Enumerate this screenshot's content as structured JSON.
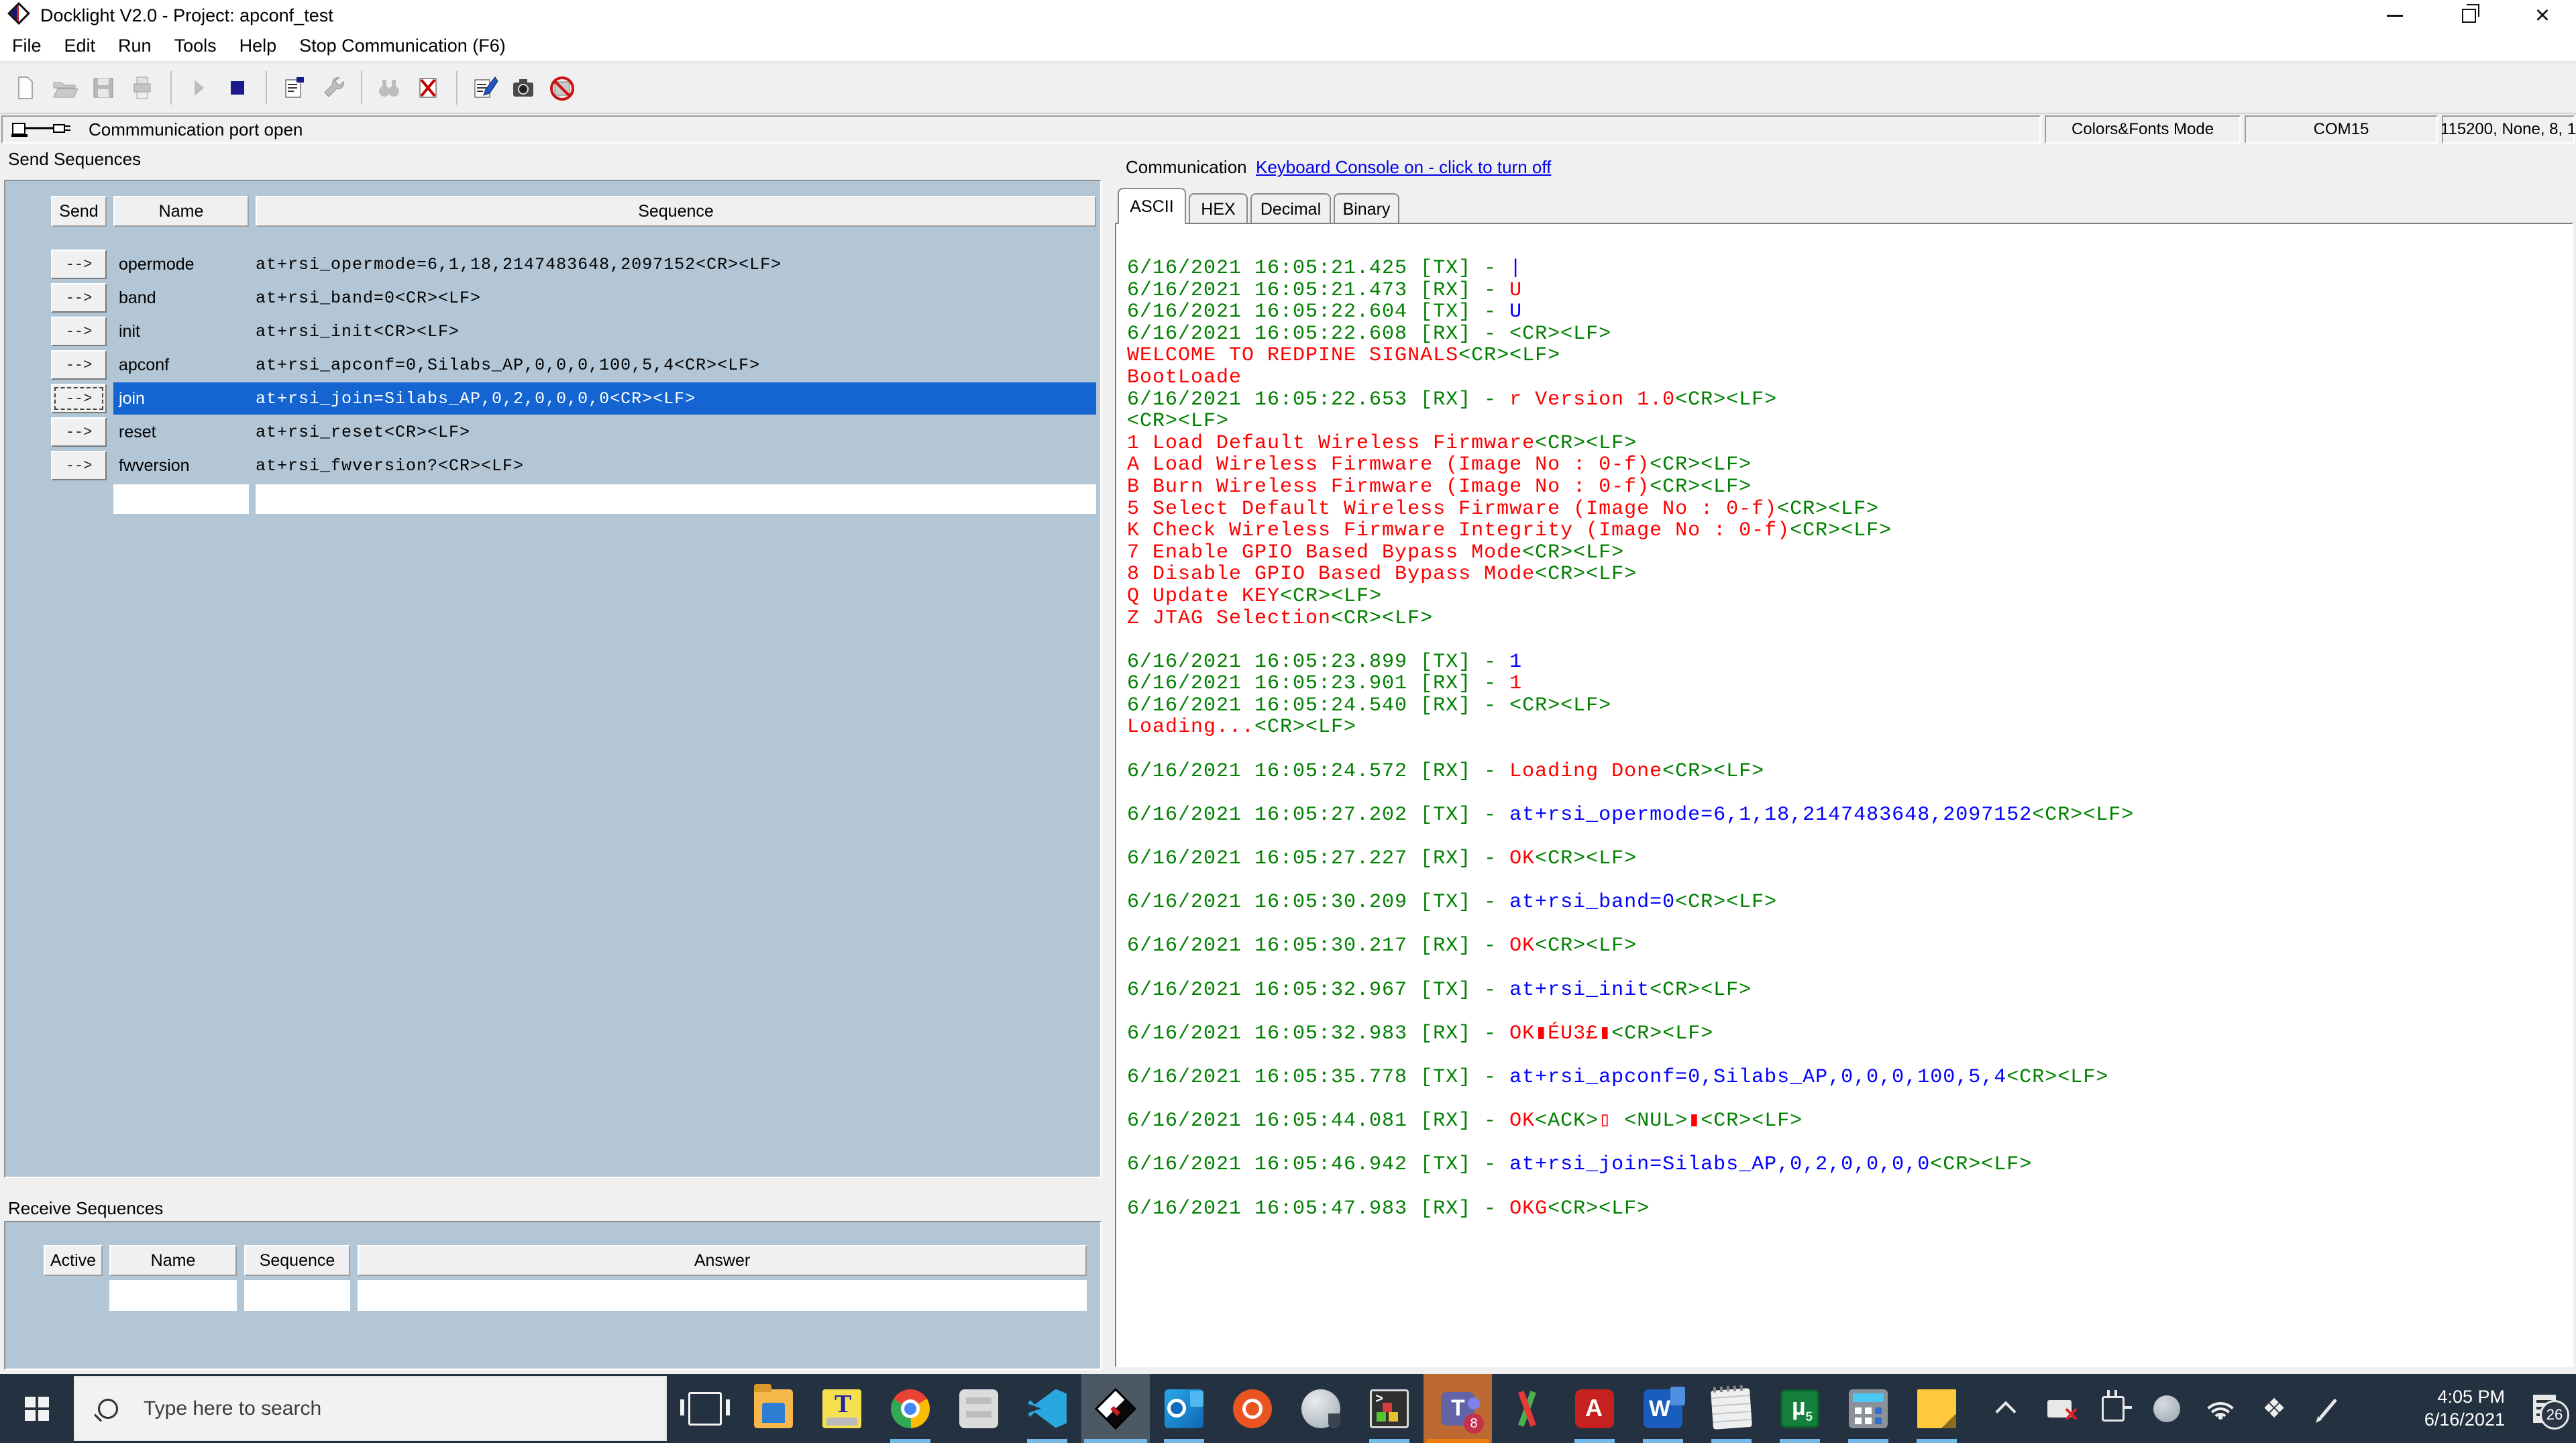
{
  "window": {
    "title": "Docklight V2.0 - Project: apconf_test",
    "menu": [
      "File",
      "Edit",
      "Run",
      "Tools",
      "Help",
      "Stop Communication  (F6)"
    ]
  },
  "toolbar": {
    "icons": [
      {
        "name": "new-project",
        "disabled": true
      },
      {
        "name": "open-project",
        "disabled": true
      },
      {
        "name": "save-project",
        "disabled": true
      },
      {
        "name": "print",
        "disabled": true
      },
      {
        "name": "sep"
      },
      {
        "name": "start-communication",
        "disabled": true
      },
      {
        "name": "stop-communication",
        "disabled": false
      },
      {
        "name": "sep"
      },
      {
        "name": "project-settings",
        "disabled": false
      },
      {
        "name": "options-wrench",
        "disabled": false
      },
      {
        "name": "sep"
      },
      {
        "name": "find-sequence",
        "disabled": true
      },
      {
        "name": "clear-communication",
        "disabled": false
      },
      {
        "name": "sep"
      },
      {
        "name": "edit-notes",
        "disabled": false
      },
      {
        "name": "snapshot-camera",
        "disabled": false
      },
      {
        "name": "keyboard-console-off",
        "disabled": false
      }
    ]
  },
  "status": {
    "message": "Commmunication port open",
    "mode": "Colors&Fonts Mode",
    "port": "COM15",
    "settings": "115200, None, 8, 1"
  },
  "send_sequences": {
    "label": "Send Sequences",
    "headers": [
      "Send",
      "Name",
      "Sequence"
    ],
    "send_button_label": "-->",
    "rows": [
      {
        "name": "opermode",
        "sequence": "at+rsi_opermode=6,1,18,2147483648,2097152<CR><LF>",
        "selected": false
      },
      {
        "name": "band",
        "sequence": "at+rsi_band=0<CR><LF>",
        "selected": false
      },
      {
        "name": "init",
        "sequence": "at+rsi_init<CR><LF>",
        "selected": false
      },
      {
        "name": "apconf",
        "sequence": "at+rsi_apconf=0,Silabs_AP,0,0,0,100,5,4<CR><LF>",
        "selected": false
      },
      {
        "name": "join",
        "sequence": "at+rsi_join=Silabs_AP,0,2,0,0,0,0<CR><LF>",
        "selected": true
      },
      {
        "name": "reset",
        "sequence": "at+rsi_reset<CR><LF>",
        "selected": false
      },
      {
        "name": "fwversion",
        "sequence": "at+rsi_fwversion?<CR><LF>",
        "selected": false
      }
    ]
  },
  "receive_sequences": {
    "label": "Receive Sequences",
    "headers": [
      "Active",
      "Name",
      "Sequence",
      "Answer"
    ]
  },
  "communication": {
    "label": "Communication",
    "keyboard_console_link": "Keyboard Console on - click to turn off",
    "tabs": [
      "ASCII",
      "HEX",
      "Decimal",
      "Binary"
    ],
    "active_tab": "ASCII",
    "lines": [
      [
        [
          "6/16/2021 16:05:21.425 [TX] - ",
          "g"
        ],
        [
          "|",
          "b"
        ]
      ],
      [
        [
          "6/16/2021 16:05:21.473 [RX] - ",
          "g"
        ],
        [
          "U",
          "r"
        ]
      ],
      [
        [
          "6/16/2021 16:05:22.604 [TX] - ",
          "g"
        ],
        [
          "U",
          "b"
        ]
      ],
      [
        [
          "6/16/2021 16:05:22.608 [RX] - <CR><LF>",
          "g"
        ]
      ],
      [
        [
          "WELCOME TO REDPINE SIGNALS",
          "r"
        ],
        [
          "<CR><LF>",
          "g"
        ]
      ],
      [
        [
          "BootLoade",
          "r"
        ]
      ],
      [
        [
          "6/16/2021 16:05:22.653 [RX] - ",
          "g"
        ],
        [
          "r Version 1.0",
          "r"
        ],
        [
          "<CR><LF>",
          "g"
        ]
      ],
      [
        [
          "<CR><LF>",
          "g"
        ]
      ],
      [
        [
          "1 Load Default Wireless Firmware",
          "r"
        ],
        [
          "<CR><LF>",
          "g"
        ]
      ],
      [
        [
          "A Load Wireless Firmware (Image No : 0-f)",
          "r"
        ],
        [
          "<CR><LF>",
          "g"
        ]
      ],
      [
        [
          "B Burn Wireless Firmware (Image No : 0-f)",
          "r"
        ],
        [
          "<CR><LF>",
          "g"
        ]
      ],
      [
        [
          "5 Select Default Wireless Firmware (Image No : 0-f)",
          "r"
        ],
        [
          "<CR><LF>",
          "g"
        ]
      ],
      [
        [
          "K Check Wireless Firmware Integrity (Image No : 0-f)",
          "r"
        ],
        [
          "<CR><LF>",
          "g"
        ]
      ],
      [
        [
          "7 Enable GPIO Based Bypass Mode",
          "r"
        ],
        [
          "<CR><LF>",
          "g"
        ]
      ],
      [
        [
          "8 Disable GPIO Based Bypass Mode",
          "r"
        ],
        [
          "<CR><LF>",
          "g"
        ]
      ],
      [
        [
          "Q Update KEY",
          "r"
        ],
        [
          "<CR><LF>",
          "g"
        ]
      ],
      [
        [
          "Z JTAG Selection",
          "r"
        ],
        [
          "<CR><LF>",
          "g"
        ]
      ],
      [],
      [
        [
          "6/16/2021 16:05:23.899 [TX] - ",
          "g"
        ],
        [
          "1",
          "b"
        ]
      ],
      [
        [
          "6/16/2021 16:05:23.901 [RX] - ",
          "g"
        ],
        [
          "1",
          "r"
        ]
      ],
      [
        [
          "6/16/2021 16:05:24.540 [RX] - <CR><LF>",
          "g"
        ]
      ],
      [
        [
          "Loading...",
          "r"
        ],
        [
          "<CR><LF>",
          "g"
        ]
      ],
      [],
      [
        [
          "6/16/2021 16:05:24.572 [RX] - ",
          "g"
        ],
        [
          "Loading Done",
          "r"
        ],
        [
          "<CR><LF>",
          "g"
        ]
      ],
      [],
      [
        [
          "6/16/2021 16:05:27.202 [TX] - ",
          "g"
        ],
        [
          "at+rsi_opermode=6,1,18,2147483648,2097152",
          "b"
        ],
        [
          "<CR><LF>",
          "g"
        ]
      ],
      [],
      [
        [
          "6/16/2021 16:05:27.227 [RX] - ",
          "g"
        ],
        [
          "OK",
          "r"
        ],
        [
          "<CR><LF>",
          "g"
        ]
      ],
      [],
      [
        [
          "6/16/2021 16:05:30.209 [TX] - ",
          "g"
        ],
        [
          "at+rsi_band=0",
          "b"
        ],
        [
          "<CR><LF>",
          "g"
        ]
      ],
      [],
      [
        [
          "6/16/2021 16:05:30.217 [RX] - ",
          "g"
        ],
        [
          "OK",
          "r"
        ],
        [
          "<CR><LF>",
          "g"
        ]
      ],
      [],
      [
        [
          "6/16/2021 16:05:32.967 [TX] - ",
          "g"
        ],
        [
          "at+rsi_init",
          "b"
        ],
        [
          "<CR><LF>",
          "g"
        ]
      ],
      [],
      [
        [
          "6/16/2021 16:05:32.983 [RX] - ",
          "g"
        ],
        [
          "OK▮ÉU3£▮",
          "r"
        ],
        [
          "<CR><LF>",
          "g"
        ]
      ],
      [],
      [
        [
          "6/16/2021 16:05:35.778 [TX] - ",
          "g"
        ],
        [
          "at+rsi_apconf=0,Silabs_AP,0,0,0,100,5,4",
          "b"
        ],
        [
          "<CR><LF>",
          "g"
        ]
      ],
      [],
      [
        [
          "6/16/2021 16:05:44.081 [RX] - ",
          "g"
        ],
        [
          "OK",
          "r"
        ],
        [
          "<ACK>",
          "g"
        ],
        [
          "▯",
          "r"
        ],
        [
          " <NUL>",
          "g"
        ],
        [
          "▮",
          "r"
        ],
        [
          "<CR><LF>",
          "g"
        ]
      ],
      [],
      [
        [
          "6/16/2021 16:05:46.942 [TX] - ",
          "g"
        ],
        [
          "at+rsi_join=Silabs_AP,0,2,0,0,0,0",
          "b"
        ],
        [
          "<CR><LF>",
          "g"
        ]
      ],
      [],
      [
        [
          "6/16/2021 16:05:47.983 [RX] - ",
          "g"
        ],
        [
          "OKG",
          "r"
        ],
        [
          "<CR><LF>",
          "g"
        ]
      ]
    ]
  },
  "taskbar": {
    "search_placeholder": "Type here to search",
    "apps": [
      {
        "name": "task-view",
        "running": false
      },
      {
        "name": "file-explorer",
        "running": false
      },
      {
        "name": "text-tool",
        "running": false
      },
      {
        "name": "chrome",
        "running": true
      },
      {
        "name": "drive-tool",
        "running": false
      },
      {
        "name": "vscode",
        "running": true
      },
      {
        "name": "docklight",
        "running": true,
        "active": true
      },
      {
        "name": "outlook",
        "running": true
      },
      {
        "name": "ubuntu",
        "running": false
      },
      {
        "name": "edge-globe",
        "running": false
      },
      {
        "name": "terminal-app",
        "running": true
      },
      {
        "name": "teams",
        "running": true,
        "accent": "orange",
        "badge": "8"
      },
      {
        "name": "compare-tool",
        "running": false
      },
      {
        "name": "acrobat",
        "running": true
      },
      {
        "name": "word",
        "running": true
      },
      {
        "name": "notepad",
        "running": true
      },
      {
        "name": "uvision",
        "running": true
      },
      {
        "name": "calculator",
        "running": true
      },
      {
        "name": "sticky-notes",
        "running": true
      }
    ],
    "tray": [
      {
        "name": "chevron-up"
      },
      {
        "name": "device-disconnected"
      },
      {
        "name": "power-plug"
      },
      {
        "name": "network-globe"
      },
      {
        "name": "wifi"
      },
      {
        "name": "dropbox"
      },
      {
        "name": "pen"
      }
    ],
    "clock": {
      "time": "4:05 PM",
      "date": "6/16/2021"
    },
    "notification_count": "26"
  },
  "colors": {
    "selection_blue": "#1464D2",
    "terminal_green": "#008000",
    "terminal_red": "#FF0000",
    "terminal_blue": "#0000FF",
    "panel_blue_gray": "#B3C6D5",
    "taskbar_dark": "#243140",
    "teams_accent_orange": "#BD6A32",
    "link_blue": "#0000EE"
  }
}
